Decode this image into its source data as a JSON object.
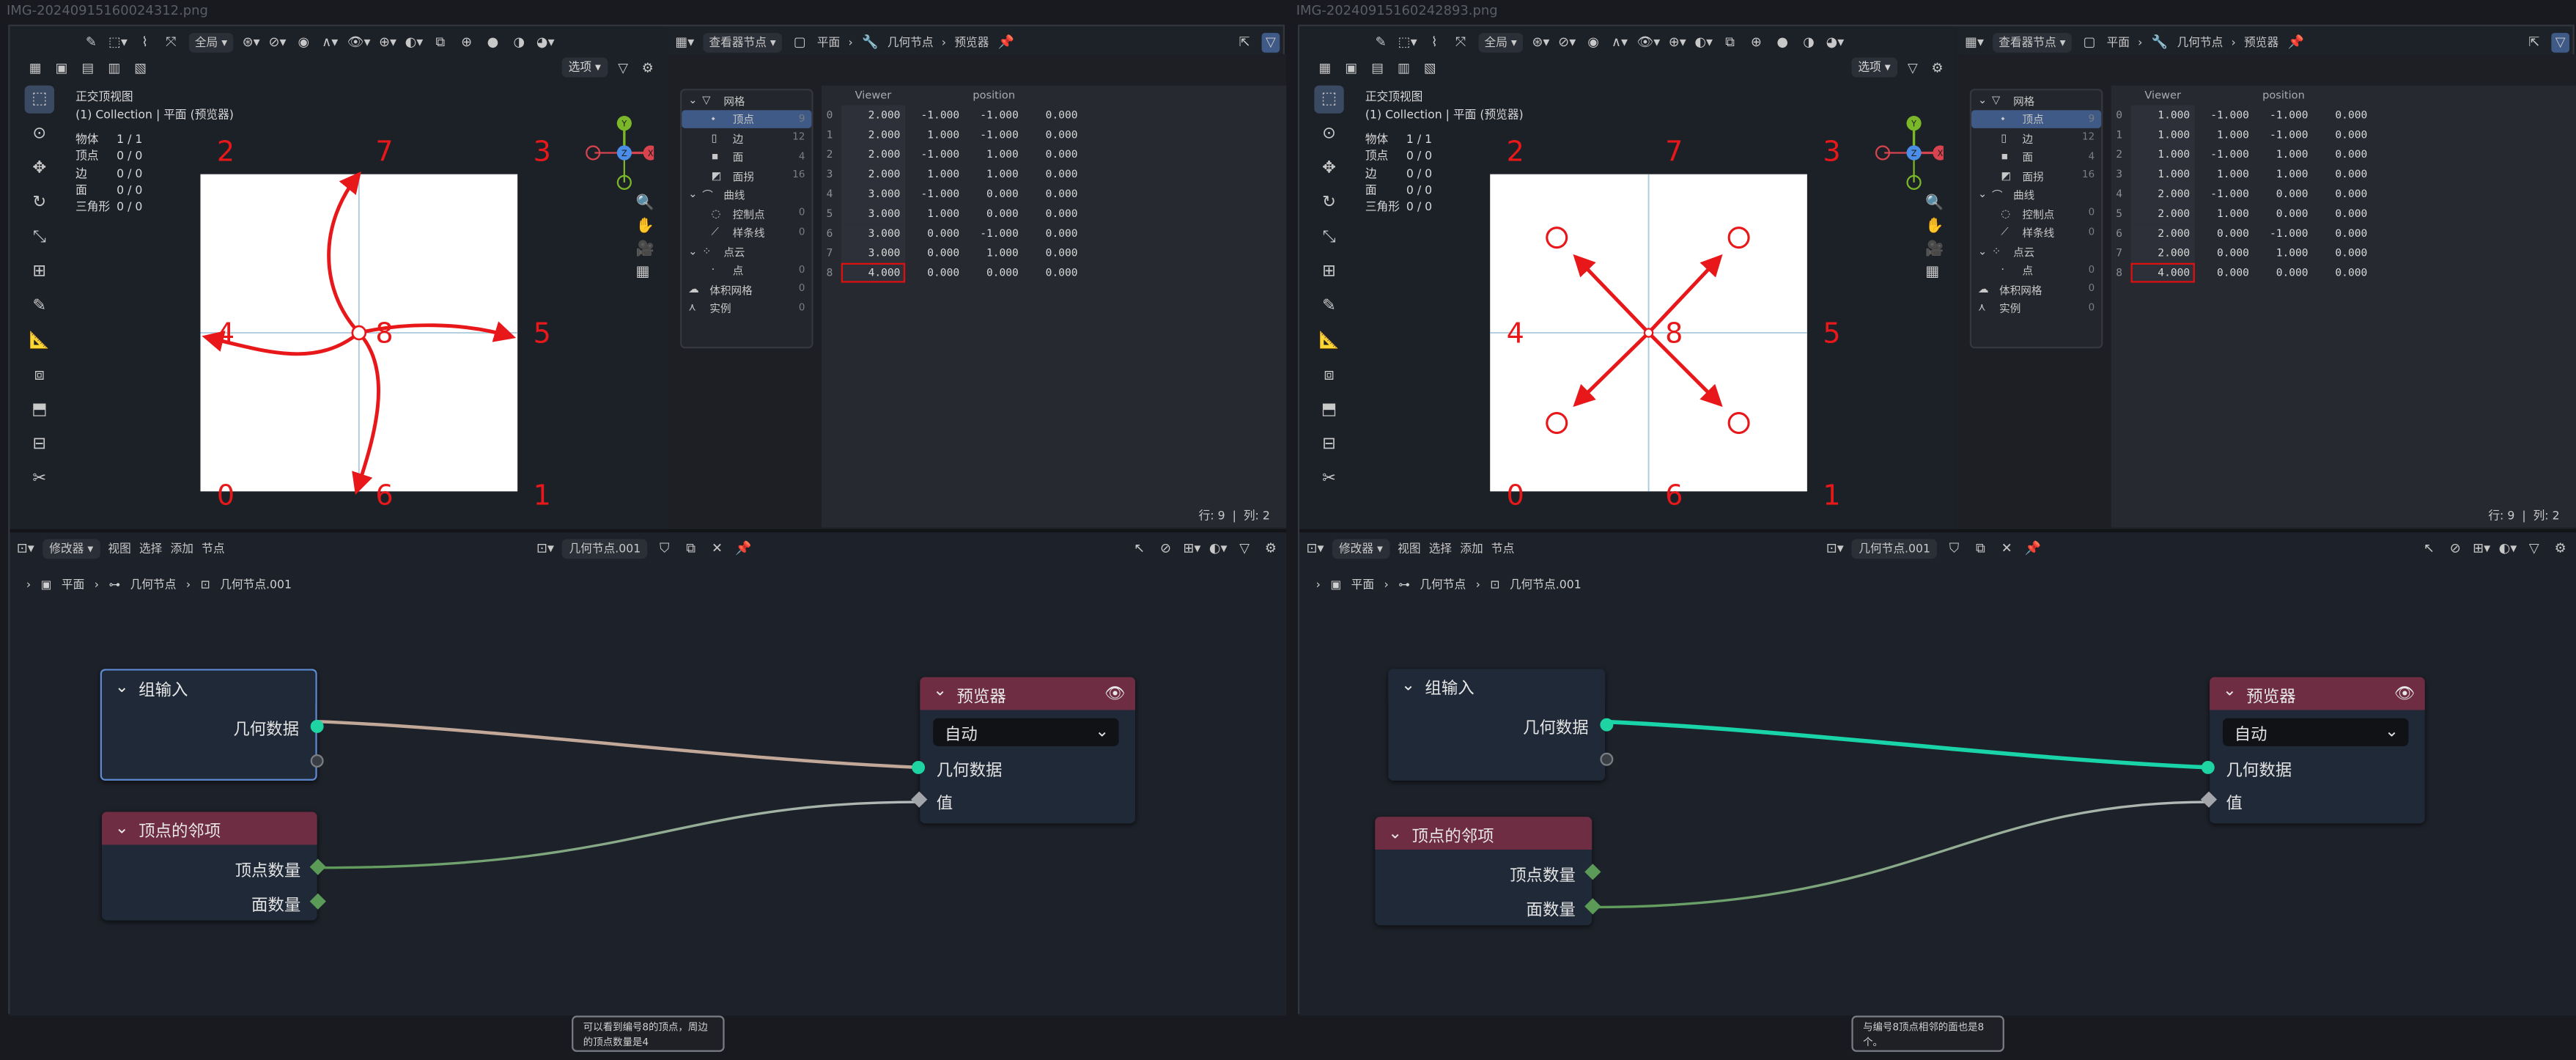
{
  "panels": [
    {
      "filename": "IMG-20240915160024312.png",
      "viewport": {
        "header": {
          "mode_global": "全局",
          "options_label": "选项"
        },
        "view_title": "正交顶视图",
        "collection_line": "(1) Collection | 平面 (预览器)",
        "stats": [
          [
            "物体",
            "1 / 1"
          ],
          [
            "顶点",
            "0 / 0"
          ],
          [
            "边",
            "0 / 0"
          ],
          [
            "面",
            "0 / 0"
          ],
          [
            "三角形",
            "0 / 0"
          ]
        ],
        "corner_labels": {
          "tl": "2",
          "tm": "7",
          "tr": "3",
          "ml": "4",
          "center": "8",
          "mr": "5",
          "bl": "0",
          "bm": "6",
          "br": "1"
        },
        "annotation_style": "curved_arrows",
        "accent_color": "#e8181a"
      },
      "spreadsheet": {
        "header": {
          "viewer_dropdown": "查看器节点",
          "crumb_1": "平面",
          "crumb_2": "几何节点",
          "crumb_3": "预览器"
        },
        "tree": [
          {
            "label": "网格",
            "count": "",
            "level": 0,
            "icon": "mesh-icon"
          },
          {
            "label": "顶点",
            "count": "9",
            "level": 1,
            "icon": "vertex-icon",
            "selected": true
          },
          {
            "label": "边",
            "count": "12",
            "level": 1,
            "icon": "edge-icon"
          },
          {
            "label": "面",
            "count": "4",
            "level": 1,
            "icon": "face-icon"
          },
          {
            "label": "面拐",
            "count": "16",
            "level": 1,
            "icon": "face-corner-icon"
          },
          {
            "label": "曲线",
            "count": "",
            "level": 0,
            "icon": "curve-icon"
          },
          {
            "label": "控制点",
            "count": "0",
            "level": 1,
            "icon": "control-point-icon"
          },
          {
            "label": "样条线",
            "count": "0",
            "level": 1,
            "icon": "spline-icon"
          },
          {
            "label": "点云",
            "count": "",
            "level": 0,
            "icon": "point-cloud-icon"
          },
          {
            "label": "点",
            "count": "0",
            "level": 1,
            "icon": "point-icon"
          },
          {
            "label": "体积网格",
            "count": "0",
            "level": 0,
            "icon": "volume-icon"
          },
          {
            "label": "实例",
            "count": "0",
            "level": 0,
            "icon": "instance-icon"
          }
        ],
        "columns": [
          "Viewer",
          "position"
        ],
        "rows": [
          {
            "i": "0",
            "viewer": "2.000",
            "x": "-1.000",
            "y": "-1.000",
            "z": "0.000"
          },
          {
            "i": "1",
            "viewer": "2.000",
            "x": "1.000",
            "y": "-1.000",
            "z": "0.000"
          },
          {
            "i": "2",
            "viewer": "2.000",
            "x": "-1.000",
            "y": "1.000",
            "z": "0.000"
          },
          {
            "i": "3",
            "viewer": "2.000",
            "x": "1.000",
            "y": "1.000",
            "z": "0.000"
          },
          {
            "i": "4",
            "viewer": "3.000",
            "x": "-1.000",
            "y": "0.000",
            "z": "0.000"
          },
          {
            "i": "5",
            "viewer": "3.000",
            "x": "1.000",
            "y": "0.000",
            "z": "0.000"
          },
          {
            "i": "6",
            "viewer": "3.000",
            "x": "0.000",
            "y": "-1.000",
            "z": "0.000"
          },
          {
            "i": "7",
            "viewer": "3.000",
            "x": "0.000",
            "y": "1.000",
            "z": "0.000"
          },
          {
            "i": "8",
            "viewer": "4.000",
            "x": "0.000",
            "y": "0.000",
            "z": "0.000",
            "highlight": true
          }
        ],
        "footer": {
          "rows": "行: 9",
          "cols": "列: 2"
        }
      },
      "node_editor": {
        "header": {
          "modifier": "修改器",
          "menu_view": "视图",
          "menu_select": "选择",
          "menu_add": "添加",
          "menu_node": "节点",
          "tree_name": "几何节点.001"
        },
        "breadcrumb": [
          "平面",
          "几何节点",
          "几何节点.001"
        ],
        "group_input": {
          "title": "组输入",
          "socket": "几何数据"
        },
        "neighbors": {
          "title": "顶点的邻项",
          "out1": "顶点数量",
          "out2": "面数量"
        },
        "viewer": {
          "title": "预览器",
          "domain": "自动",
          "in_geometry": "几何数据",
          "in_value": "值"
        },
        "wire_vertex_count": true,
        "geometry_wire_color": "#c2a898"
      },
      "caption": "可以看到编号8的顶点，周边的顶点数量是4"
    },
    {
      "filename": "IMG-20240915160242893.png",
      "viewport": {
        "header": {
          "mode_global": "全局",
          "options_label": "选项"
        },
        "view_title": "正交顶视图",
        "collection_line": "(1) Collection | 平面 (预览器)",
        "stats": [
          [
            "物体",
            "1 / 1"
          ],
          [
            "顶点",
            "0 / 0"
          ],
          [
            "边",
            "0 / 0"
          ],
          [
            "面",
            "0 / 0"
          ],
          [
            "三角形",
            "0 / 0"
          ]
        ],
        "corner_labels": {
          "tl": "2",
          "tm": "7",
          "tr": "3",
          "ml": "4",
          "center": "8",
          "mr": "5",
          "bl": "0",
          "bm": "6",
          "br": "1"
        },
        "annotation_style": "diagonal_arrows",
        "accent_color": "#e8181a"
      },
      "spreadsheet": {
        "header": {
          "viewer_dropdown": "查看器节点",
          "crumb_1": "平面",
          "crumb_2": "几何节点",
          "crumb_3": "预览器"
        },
        "tree": [
          {
            "label": "网格",
            "count": "",
            "level": 0,
            "icon": "mesh-icon"
          },
          {
            "label": "顶点",
            "count": "9",
            "level": 1,
            "icon": "vertex-icon",
            "selected": true
          },
          {
            "label": "边",
            "count": "12",
            "level": 1,
            "icon": "edge-icon"
          },
          {
            "label": "面",
            "count": "4",
            "level": 1,
            "icon": "face-icon"
          },
          {
            "label": "面拐",
            "count": "16",
            "level": 1,
            "icon": "face-corner-icon"
          },
          {
            "label": "曲线",
            "count": "",
            "level": 0,
            "icon": "curve-icon"
          },
          {
            "label": "控制点",
            "count": "0",
            "level": 1,
            "icon": "control-point-icon"
          },
          {
            "label": "样条线",
            "count": "0",
            "level": 1,
            "icon": "spline-icon"
          },
          {
            "label": "点云",
            "count": "",
            "level": 0,
            "icon": "point-cloud-icon"
          },
          {
            "label": "点",
            "count": "0",
            "level": 1,
            "icon": "point-icon"
          },
          {
            "label": "体积网格",
            "count": "0",
            "level": 0,
            "icon": "volume-icon"
          },
          {
            "label": "实例",
            "count": "0",
            "level": 0,
            "icon": "instance-icon"
          }
        ],
        "columns": [
          "Viewer",
          "position"
        ],
        "rows": [
          {
            "i": "0",
            "viewer": "1.000",
            "x": "-1.000",
            "y": "-1.000",
            "z": "0.000"
          },
          {
            "i": "1",
            "viewer": "1.000",
            "x": "1.000",
            "y": "-1.000",
            "z": "0.000"
          },
          {
            "i": "2",
            "viewer": "1.000",
            "x": "-1.000",
            "y": "1.000",
            "z": "0.000"
          },
          {
            "i": "3",
            "viewer": "1.000",
            "x": "1.000",
            "y": "1.000",
            "z": "0.000"
          },
          {
            "i": "4",
            "viewer": "2.000",
            "x": "-1.000",
            "y": "0.000",
            "z": "0.000"
          },
          {
            "i": "5",
            "viewer": "2.000",
            "x": "1.000",
            "y": "0.000",
            "z": "0.000"
          },
          {
            "i": "6",
            "viewer": "2.000",
            "x": "0.000",
            "y": "-1.000",
            "z": "0.000"
          },
          {
            "i": "7",
            "viewer": "2.000",
            "x": "0.000",
            "y": "1.000",
            "z": "0.000"
          },
          {
            "i": "8",
            "viewer": "4.000",
            "x": "0.000",
            "y": "0.000",
            "z": "0.000",
            "highlight": true
          }
        ],
        "footer": {
          "rows": "行: 9",
          "cols": "列: 2"
        }
      },
      "node_editor": {
        "header": {
          "modifier": "修改器",
          "menu_view": "视图",
          "menu_select": "选择",
          "menu_add": "添加",
          "menu_node": "节点",
          "tree_name": "几何节点.001"
        },
        "breadcrumb": [
          "平面",
          "几何节点",
          "几何节点.001"
        ],
        "group_input": {
          "title": "组输入",
          "socket": "几何数据"
        },
        "neighbors": {
          "title": "顶点的邻项",
          "out1": "顶点数量",
          "out2": "面数量"
        },
        "viewer": {
          "title": "预览器",
          "domain": "自动",
          "in_geometry": "几何数据",
          "in_value": "值"
        },
        "wire_vertex_count": false,
        "geometry_wire_color": "#19d4a8"
      },
      "caption": "与编号8顶点相邻的面也是8个。"
    }
  ]
}
